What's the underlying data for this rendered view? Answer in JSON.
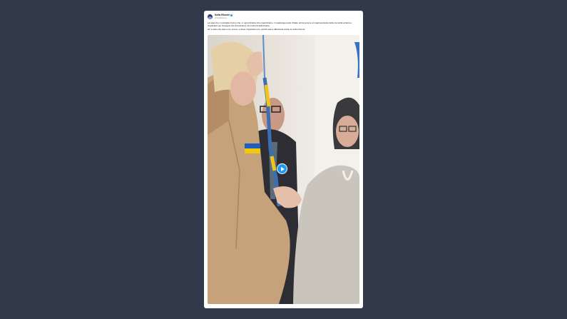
{
  "tweet": {
    "author_name": "Sofia Elsenie",
    "author_handle": "@SofiaElsenie",
    "paragraphs": [
      "La casa che ci consiglia di più è che, in ogni iniziativa che organizziamo, in qualunque parte d'Italia, arriva sempre un rappresentante della comunità ucraina a ringraziarci per l'impegno che dimostriamo nei confronti dell'Ucraina.",
      "Ieri è stato che siamo noi, invece, a dover ringraziare loro, perché siamo affezionati anche la nostra Nonna."
    ],
    "verified_icon": "verified-badge-icon",
    "media": {
      "type": "video",
      "play_icon": "play-icon",
      "accent": "#1d9bf0"
    }
  },
  "colors": {
    "page_background": "#323a4a",
    "card_background": "#ffffff",
    "text_primary": "#0f1419",
    "text_secondary": "#8b98a5"
  }
}
